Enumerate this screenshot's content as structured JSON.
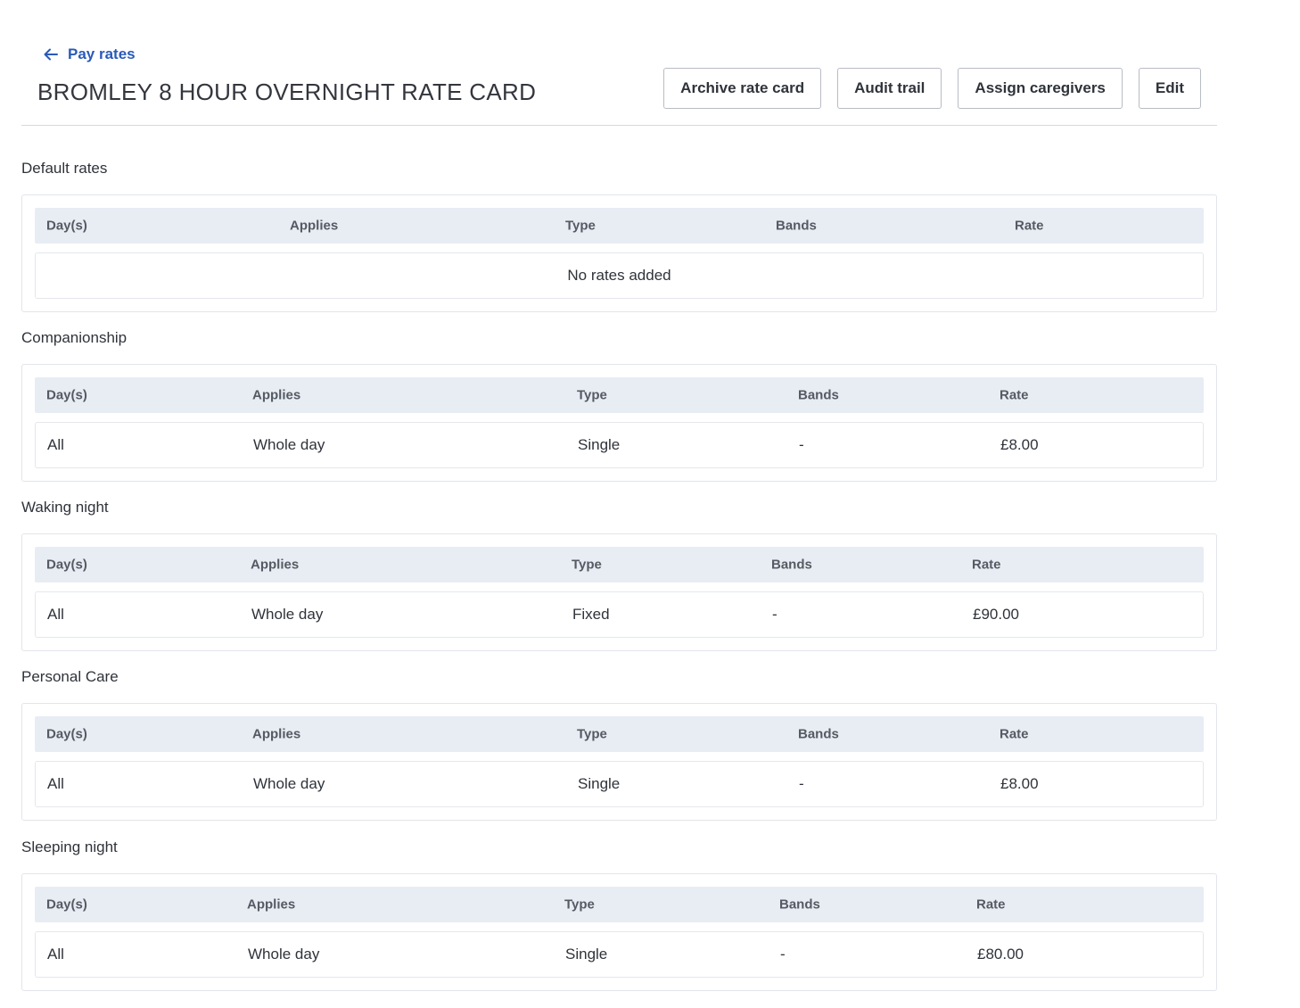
{
  "back_link": {
    "label": "Pay rates"
  },
  "title": "BROMLEY 8 HOUR OVERNIGHT RATE CARD",
  "actions": {
    "archive": "Archive rate card",
    "audit": "Audit trail",
    "assign": "Assign caregivers",
    "edit": "Edit"
  },
  "columns": [
    "Day(s)",
    "Applies",
    "Type",
    "Bands",
    "Rate"
  ],
  "sections": [
    {
      "title": "Default rates",
      "empty_text": "No rates added",
      "rows": []
    },
    {
      "title": "Companionship",
      "rows": [
        {
          "days": "All",
          "applies": "Whole day",
          "type": "Single",
          "bands": "-",
          "rate": "£8.00"
        }
      ]
    },
    {
      "title": "Waking night",
      "rows": [
        {
          "days": "All",
          "applies": "Whole day",
          "type": "Fixed",
          "bands": "-",
          "rate": "£90.00"
        }
      ]
    },
    {
      "title": "Personal Care",
      "rows": [
        {
          "days": "All",
          "applies": "Whole day",
          "type": "Single",
          "bands": "-",
          "rate": "£8.00"
        }
      ]
    },
    {
      "title": "Sleeping night",
      "rows": [
        {
          "days": "All",
          "applies": "Whole day",
          "type": "Single",
          "bands": "-",
          "rate": "£80.00"
        }
      ]
    }
  ]
}
